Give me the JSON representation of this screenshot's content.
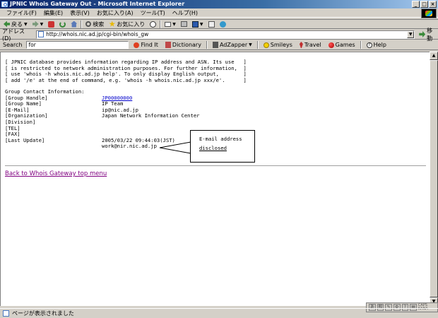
{
  "window": {
    "title": "JPNIC Whois Gateway Out - Microsoft Internet Explorer",
    "buttons": {
      "minimize": "_",
      "maximize": "□",
      "close": "×"
    }
  },
  "menu": [
    {
      "name": "file",
      "label": "ファイル(F)"
    },
    {
      "name": "edit",
      "label": "編集(E)"
    },
    {
      "name": "view",
      "label": "表示(V)"
    },
    {
      "name": "favorites",
      "label": "お気に入り(A)"
    },
    {
      "name": "tools",
      "label": "ツール(T)"
    },
    {
      "name": "help",
      "label": "ヘルプ(H)"
    }
  ],
  "toolbar": {
    "back_label": "戻る",
    "search_label": "検索",
    "favorites_label": "お気に入り"
  },
  "address": {
    "label": "アドレス(D)",
    "url": "http://whois.nic.ad.jp/cgi-bin/whois_gw",
    "go_label": "移動"
  },
  "searchbar": {
    "label": "Search",
    "query": "for",
    "buttons": [
      {
        "name": "findit",
        "label": "Find It",
        "icon": "findit-icon"
      },
      {
        "name": "dictionary",
        "label": "Dictionary",
        "icon": "dictionary-icon"
      },
      {
        "name": "adzapper",
        "label": "AdZapper",
        "icon": "adzapper-icon"
      },
      {
        "name": "smileys",
        "label": "Smileys",
        "icon": "smiley-icon"
      },
      {
        "name": "travel",
        "label": "Travel",
        "icon": "travel-icon"
      },
      {
        "name": "games",
        "label": "Games",
        "icon": "games-icon"
      },
      {
        "name": "help",
        "label": "Help",
        "icon": "help-icon"
      }
    ]
  },
  "page": {
    "notice": [
      "[ JPNIC database provides information regarding IP address and ASN. Its use   ]",
      "[ is restricted to network administration purposes. For further information,  ]",
      "[ use 'whois -h whois.nic.ad.jp help'. To only display English output,        ]",
      "[ add '/e' at the end of command, e.g. 'whois -h whois.nic.ad.jp xxx/e'.      ]"
    ],
    "section_title": "Group Contact Information:",
    "fields": [
      {
        "label": "[Group Handle]",
        "value": "JP00000000",
        "link": true
      },
      {
        "label": "[Group Name]",
        "value": "IP Team"
      },
      {
        "label": "[E-Mail]",
        "value": "ip@nic.ad.jp"
      },
      {
        "label": "[Organization]",
        "value": "Japan Network Information Center"
      },
      {
        "label": "[Division]",
        "value": ""
      },
      {
        "label": "[TEL]",
        "value": ""
      },
      {
        "label": "[FAX]",
        "value": ""
      },
      {
        "label": "[Last Update]",
        "value": "2005/03/22 09:44:03(JST)"
      },
      {
        "label": "",
        "value": "work@nir.nic.ad.jp"
      }
    ],
    "callout": {
      "line1": "E-mail address",
      "line2": "disclosed"
    },
    "back_link": "Back to Whois Gateway top menu"
  },
  "langbar": {
    "caps": "CAPS\nKANA"
  },
  "status": {
    "text": "ページが表示されました"
  },
  "colors": {
    "title_start": "#0a246a",
    "title_end": "#a6caf0",
    "link": "#0000cc",
    "visited": "#800080"
  }
}
